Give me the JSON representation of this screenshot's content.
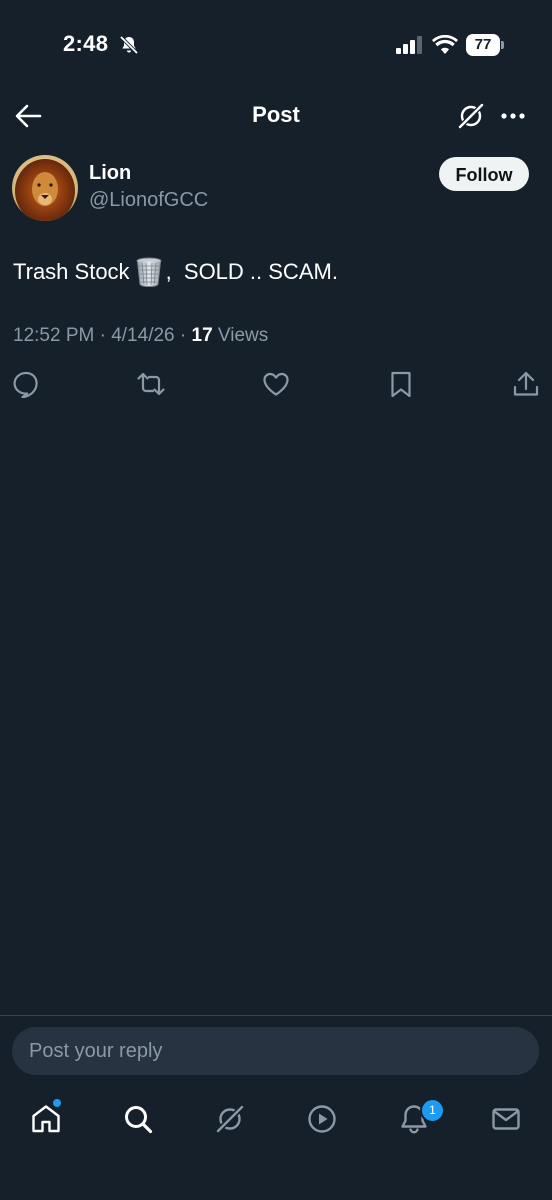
{
  "status_bar": {
    "time": "2:48",
    "battery": "77",
    "icons": [
      "bell-muted-icon",
      "signal-icon",
      "wifi-icon",
      "battery-icon"
    ]
  },
  "header": {
    "title": "Post",
    "icons": [
      "back-arrow-icon",
      "grok-icon",
      "more-icon"
    ]
  },
  "post": {
    "author_name": "Lion",
    "author_handle": "@LionofGCC",
    "follow_label": "Follow",
    "text_before": "Trash Stock",
    "text_after": ",  SOLD .. SCAM.",
    "emoji": "wastebasket",
    "meta_time": "12:52 PM · 4/14/26 · ",
    "views_count": "17",
    "views_label": " Views"
  },
  "actions": [
    "reply-icon",
    "repost-icon",
    "like-icon",
    "bookmark-icon",
    "share-icon"
  ],
  "reply": {
    "placeholder": "Post your reply"
  },
  "bottom_nav": {
    "items": [
      "home-icon",
      "search-icon",
      "grok-icon",
      "video-icon",
      "notifications-icon",
      "messages-icon"
    ],
    "notification_count": "1"
  },
  "colors": {
    "background": "#15202b",
    "accent": "#1d9bf0",
    "secondary_text": "#8b98a5"
  }
}
